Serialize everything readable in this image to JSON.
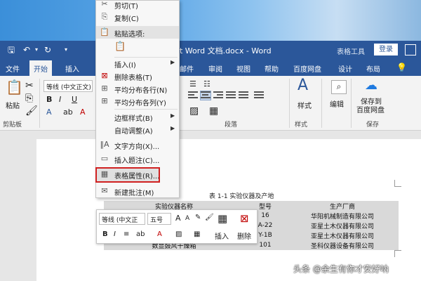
{
  "titlebar": {
    "doc_title": "t Word 文档.docx - Word",
    "tools_label": "表格工具",
    "login_label": "登录"
  },
  "tabs": [
    {
      "label": "文件"
    },
    {
      "label": "开始"
    },
    {
      "label": "插入"
    },
    {
      "label": "邮件"
    },
    {
      "label": "审阅"
    },
    {
      "label": "视图"
    },
    {
      "label": "帮助"
    },
    {
      "label": "百度网盘"
    },
    {
      "label": "设计"
    },
    {
      "label": "布局"
    }
  ],
  "ribbon": {
    "paste_label": "粘贴",
    "clipboard_group": "剪贴板",
    "font_name": "等线 (中文正文)",
    "paragraph_group": "段落",
    "styles_label": "样式",
    "styles_group": "样式",
    "edit_label": "编辑",
    "save_label_1": "保存到",
    "save_label_2": "百度网盘",
    "save_group": "保存"
  },
  "context_menu": {
    "items": [
      {
        "label": "剪切(T)",
        "icon": "scissors-icon"
      },
      {
        "label": "复制(C)",
        "icon": "copy-icon"
      },
      {
        "label": "插入(I)",
        "icon": "none",
        "submenu": true
      },
      {
        "label": "删除表格(T)",
        "icon": "delete-table-icon"
      },
      {
        "label": "平均分布各行(N)",
        "icon": "distribute-rows-icon"
      },
      {
        "label": "平均分布各列(Y)",
        "icon": "distribute-cols-icon"
      },
      {
        "label": "边框样式(B)",
        "icon": "none",
        "submenu": true
      },
      {
        "label": "自动调整(A)",
        "icon": "none",
        "submenu": true
      },
      {
        "label": "文字方向(X)...",
        "icon": "text-direction-icon"
      },
      {
        "label": "插入题注(C)...",
        "icon": "caption-icon"
      },
      {
        "label": "表格属性(R)...",
        "icon": "table-properties-icon",
        "highlighted": true
      },
      {
        "label": "新建批注(M)",
        "icon": "comment-icon"
      }
    ],
    "paste_header": "粘贴选项:"
  },
  "document": {
    "caption": "表 1-1 实验仪器及产地",
    "table": {
      "headers": [
        "实验仪器名称",
        "型号",
        "生产厂商"
      ],
      "rows": [
        [
          "",
          "16",
          "华阳机械制造有限公司"
        ],
        [
          "",
          "A-22",
          "亚星土木仪器有限公司"
        ],
        [
          "",
          "Y-1B",
          "亚星土木仪器有限公司"
        ],
        [
          "数显鼓风干燥箱",
          "101",
          "圣科仪器设备有限公司"
        ]
      ]
    }
  },
  "mini_toolbar": {
    "font_name": "等线 (中文正",
    "font_size": "五号",
    "insert_label": "插入",
    "delete_label": "删除"
  },
  "watermark": "头条 @余生有你才安好呐"
}
